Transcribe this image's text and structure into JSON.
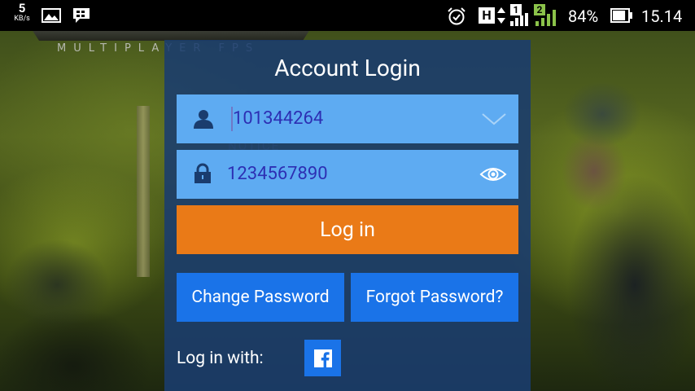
{
  "status_bar": {
    "net_speed": "5",
    "net_speed_unit": "KB/s",
    "network_type": "H",
    "sim1_label": "1",
    "sim2_label": "2",
    "battery_percent": "84%",
    "battery_level": 0.84,
    "time": "15.14",
    "icons": [
      "gallery-icon",
      "bbm-icon",
      "alarm-icon",
      "network-h-icon",
      "signal-icon",
      "battery-icon"
    ]
  },
  "dialog": {
    "title": "Account Login",
    "account": {
      "value": "101344264",
      "icon": "user-icon",
      "dropdown_icon": "chevron-down-icon"
    },
    "password": {
      "value": "1234567890",
      "icon": "lock-icon",
      "reveal_icon": "eye-icon"
    },
    "login_label": "Log in",
    "change_password_label": "Change Password",
    "forgot_password_label": "Forgot Password?",
    "login_with_label": "Log in with:",
    "social_icon": "facebook-icon"
  },
  "colors": {
    "dialog_bg": "#1a3c6e",
    "field_bg": "#5eabf2",
    "field_text": "#2d2fb3",
    "login_button": "#ea7a17",
    "secondary_button": "#1a73e8"
  }
}
